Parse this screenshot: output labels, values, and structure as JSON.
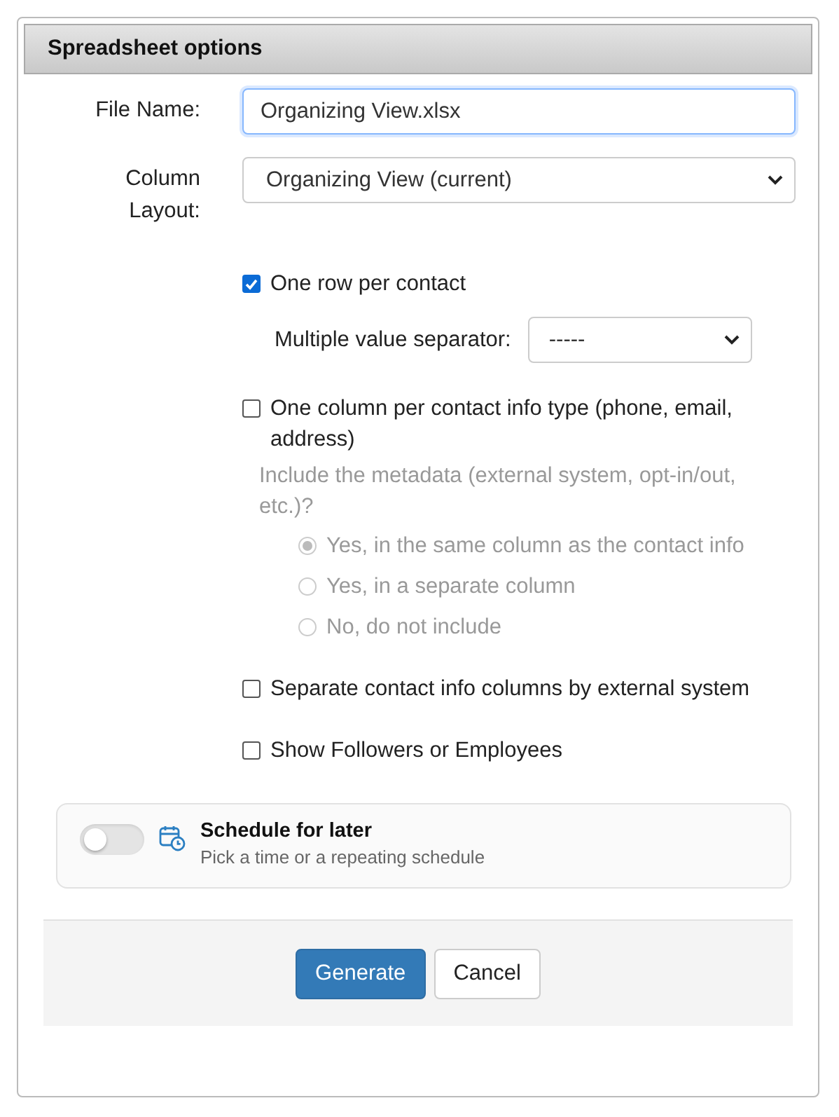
{
  "panel": {
    "title": "Spreadsheet options"
  },
  "fields": [
    {
      "kind": "text",
      "label": "File Name:",
      "value": "Organizing View.xlsx"
    },
    {
      "kind": "select",
      "label": "Column Layout:",
      "value": "Organizing View (current)"
    }
  ],
  "options": [
    {
      "kind": "checkbox",
      "label": "One row per contact",
      "checked": true,
      "children": [
        {
          "kind": "select",
          "label": "Multiple value separator:",
          "value": "-----"
        }
      ]
    },
    {
      "kind": "checkbox",
      "label": "One column per contact info type (phone, email, address)",
      "checked": false,
      "children": [
        {
          "kind": "question",
          "label": "Include the metadata (external system, opt-in/out, etc.)?",
          "disabled": true,
          "children": [
            {
              "kind": "radio",
              "label": "Yes, in the same column as the contact info",
              "selected": true,
              "disabled": true
            },
            {
              "kind": "radio",
              "label": "Yes, in a separate column",
              "selected": false,
              "disabled": true
            },
            {
              "kind": "radio",
              "label": "No, do not include",
              "selected": false,
              "disabled": true
            }
          ]
        }
      ]
    },
    {
      "kind": "checkbox",
      "label": "Separate contact info columns by external system",
      "checked": false
    },
    {
      "kind": "checkbox",
      "label": "Show Followers or Employees",
      "checked": false
    }
  ],
  "schedule": {
    "title": "Schedule for later",
    "subtitle": "Pick a time or a repeating schedule",
    "on": false
  },
  "buttons": [
    {
      "label": "Generate",
      "kind": "primary"
    },
    {
      "label": "Cancel",
      "kind": "default"
    }
  ]
}
